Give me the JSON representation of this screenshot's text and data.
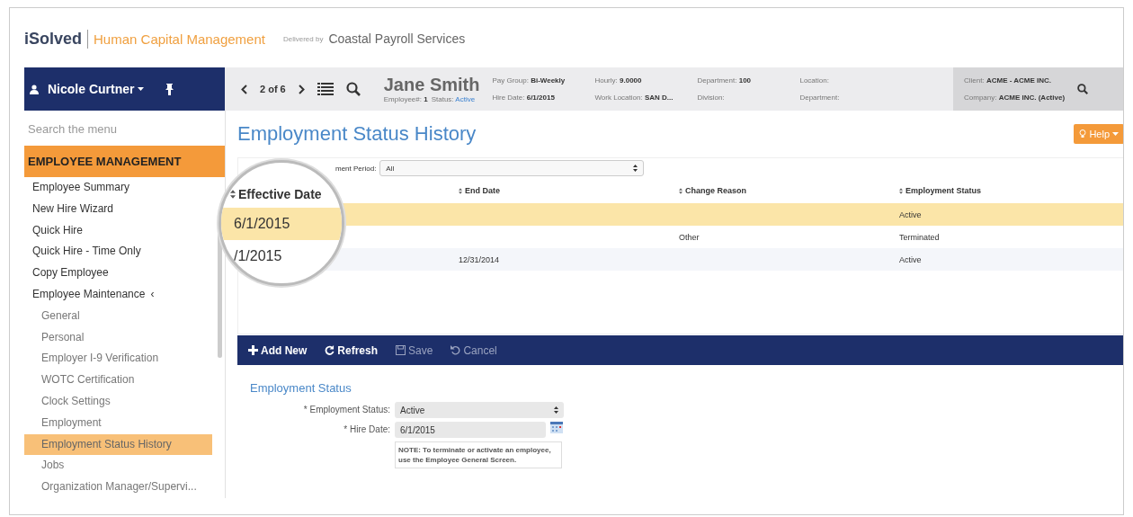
{
  "brand": {
    "logo": "iSolved",
    "product": "Human Capital Management",
    "delivered_by": "Delivered by",
    "provider": "Coastal Payroll Services"
  },
  "user": {
    "name": "Nicole Curtner"
  },
  "employee_bar": {
    "pager": "2 of 6",
    "name": "Jane Smith",
    "employee_no_label": "Employee#:",
    "employee_no": "1",
    "status_label": "Status:",
    "status": "Active",
    "fields": [
      [
        {
          "label": "Pay Group:",
          "value": "Bi-Weekly"
        },
        {
          "label": "Hire Date:",
          "value": "6/1/2015"
        }
      ],
      [
        {
          "label": "Hourly:",
          "value": "9.0000"
        },
        {
          "label": "Work Location:",
          "value": "SAN D..."
        }
      ],
      [
        {
          "label": "Department:",
          "value": "100"
        },
        {
          "label": "Division:"
        }
      ],
      [
        {
          "label": "Location:"
        },
        {
          "label": "Department:"
        }
      ]
    ],
    "client": [
      {
        "label": "Client:",
        "value": "ACME - ACME INC."
      },
      {
        "label": "Company:",
        "value": "ACME INC. (Active)"
      }
    ]
  },
  "sidebar": {
    "search_placeholder": "Search the menu",
    "section": "EMPLOYEE MANAGEMENT",
    "items": [
      {
        "label": "Employee Summary",
        "selected": false
      },
      {
        "label": "New Hire Wizard",
        "selected": false
      },
      {
        "label": "Quick Hire",
        "selected": false
      },
      {
        "label": "Quick Hire - Time Only",
        "selected": false
      },
      {
        "label": "Copy Employee",
        "selected": false
      },
      {
        "label": "Employee Maintenance",
        "selected": false,
        "expanded": true,
        "toggle": "‹",
        "children": [
          {
            "label": "General",
            "selected": false
          },
          {
            "label": "Personal",
            "selected": false
          },
          {
            "label": "Employer I-9 Verification",
            "selected": false
          },
          {
            "label": "WOTC Certification",
            "selected": false
          },
          {
            "label": "Clock Settings",
            "selected": false
          },
          {
            "label": "Employment",
            "selected": false
          },
          {
            "label": "Employment Status History",
            "selected": true
          },
          {
            "label": "Jobs",
            "selected": false
          },
          {
            "label": "Organization Manager/Supervi...",
            "selected": false
          }
        ]
      }
    ]
  },
  "page": {
    "title": "Employment Status History",
    "help": "Help",
    "period_label": "ment Period:",
    "period_value": "All"
  },
  "table": {
    "columns": [
      "Effective Date",
      "End Date",
      "Change Reason",
      "Employment Status"
    ],
    "rows": [
      {
        "effective_date": "6/1/2015",
        "end_date": "",
        "change_reason": "",
        "employment_status": "Active",
        "selected": true
      },
      {
        "effective_date": "/1/2015",
        "end_date": "",
        "change_reason": "Other",
        "employment_status": "Terminated",
        "selected": false
      },
      {
        "end_date": "12/31/2014",
        "change_reason": "",
        "employment_status": "Active",
        "selected": false
      }
    ]
  },
  "toolbar": [
    {
      "label": "Add New",
      "kind": "add",
      "disabled": false
    },
    {
      "label": "Refresh",
      "kind": "refresh",
      "disabled": false
    },
    {
      "label": "Save",
      "kind": "save",
      "disabled": true
    },
    {
      "label": "Cancel",
      "kind": "cancel",
      "disabled": true
    }
  ],
  "form": {
    "title": "Employment Status",
    "status_label": "* Employment Status:",
    "status_value": "Active",
    "hire_label": "* Hire Date:",
    "hire_value": "6/1/2015",
    "note": "NOTE: To terminate or activate an employee, use the Employee General Screen."
  }
}
